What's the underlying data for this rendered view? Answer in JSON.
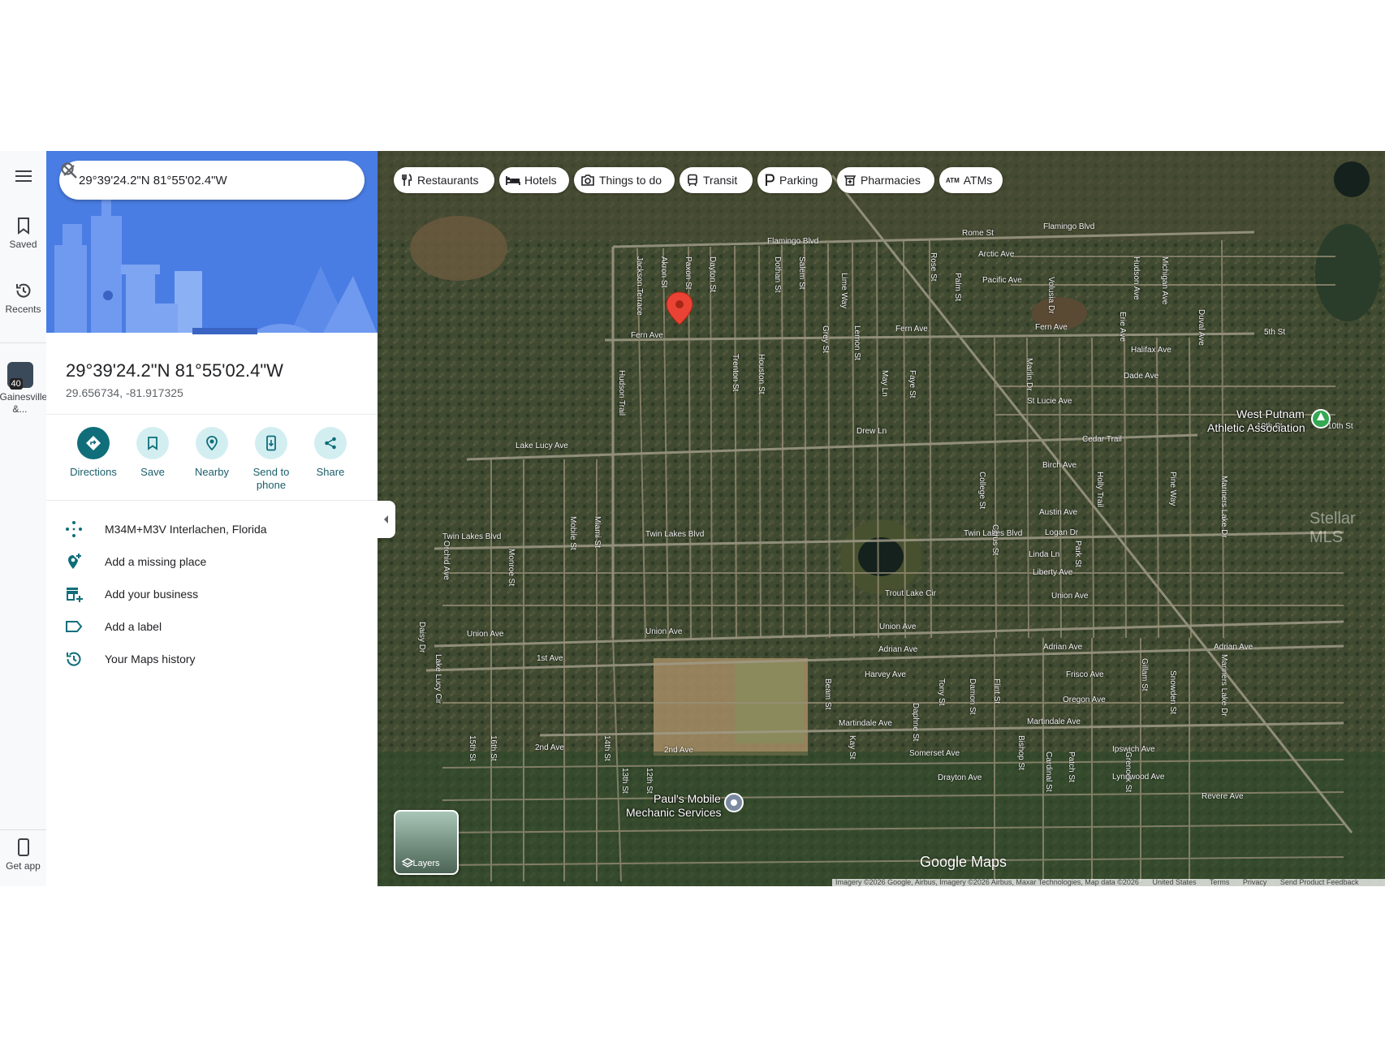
{
  "rail": {
    "saved_label": "Saved",
    "recents_label": "Recents",
    "recent_place_label": "Gainesville &...",
    "recent_place_badge": "40",
    "get_app_label": "Get app"
  },
  "search": {
    "value": "29°39'24.2\"N 81°55'02.4\"W"
  },
  "place": {
    "title": "29°39'24.2\"N 81°55'02.4\"W",
    "coords": "29.656734, -81.917325"
  },
  "actions": {
    "directions": "Directions",
    "save": "Save",
    "nearby": "Nearby",
    "send_line1": "Send to",
    "send_line2": "phone",
    "share": "Share"
  },
  "info": {
    "plus_code": "M34M+M3V Interlachen, Florida",
    "add_missing_place": "Add a missing place",
    "add_business": "Add your business",
    "add_label": "Add a label",
    "maps_history": "Your Maps history"
  },
  "chips": {
    "restaurants": "Restaurants",
    "hotels": "Hotels",
    "things_to_do": "Things to do",
    "transit": "Transit",
    "parking": "Parking",
    "pharmacies": "Pharmacies",
    "atms": "ATMs",
    "atm_glyph": "ATM"
  },
  "map": {
    "layers_label": "Layers",
    "logo": "Google Maps",
    "watermark": "Stellar MLS",
    "poi_west_putnam_1": "West Putnam",
    "poi_west_putnam_2": "Athletic Association",
    "poi_pauls_1": "Paul's Mobile",
    "poi_pauls_2": "Mechanic Services",
    "attribution": "Imagery ©2026 Google, Airbus, Imagery ©2026 Airbus, Maxar Technologies, Map data ©2026",
    "attr_us": "United States",
    "attr_terms": "Terms",
    "attr_privacy": "Privacy",
    "attr_feedback": "Send Product Feedback",
    "streets_h": [
      "Flamingo Blvd",
      "Rome St",
      "Flamingo Blvd",
      "Arctic Ave",
      "Pacific Ave",
      "Fern Ave",
      "Fern Ave",
      "Fern Ave",
      "5th St",
      "Halifax Ave",
      "Dade Ave",
      "St Lucie Ave",
      "10th St",
      "10th St",
      "Drew Ln",
      "Lake Lucy Ave",
      "Cedar Trail",
      "Birch Ave",
      "Austin Ave",
      "Twin Lakes Blvd",
      "Twin Lakes Blvd",
      "Twin Lakes Blvd",
      "Logan Dr",
      "Linda Ln",
      "Liberty Ave",
      "Union Ave",
      "Union Ave",
      "Union Ave",
      "Union Ave",
      "1st Ave",
      "Adrian Ave",
      "Adrian Ave",
      "Adrian Ave",
      "Harvey Ave",
      "Frisco Ave",
      "Oregon Ave",
      "Martindale Ave",
      "Martindale Ave",
      "2nd Ave",
      "2nd Ave",
      "Somerset Ave",
      "Ipswich Ave",
      "Drayton Ave",
      "Lynnwood Ave",
      "Revere Ave",
      "Trout Lake Cir"
    ],
    "streets_v": [
      "Jackson Terrace",
      "Akron St",
      "Paxon St",
      "Dayton St",
      "Dothan St",
      "Salem St",
      "Lime Way",
      "Rose St",
      "Palm St",
      "Volusia Dr",
      "Hudson Ave",
      "Michigan Ave",
      "Duval Ave",
      "Hudson Trail",
      "Trenton St",
      "Houston St",
      "Lemon St",
      "Grey St",
      "May Ln",
      "Faye St",
      "Marlin Dr",
      "Erie Ave",
      "College St",
      "Holly Trail",
      "Pine Way",
      "Mariners Lake Dr",
      "Mobile St",
      "Miami St",
      "Orchid Ave",
      "Monroe St",
      "Citrus St",
      "Park St",
      "Beam St",
      "Tony St",
      "Damon St",
      "Flint St",
      "Daphne St",
      "Gillam St",
      "Snowden St",
      "Lake Lucy Cir",
      "15th St",
      "16th St",
      "14th St",
      "13th St",
      "12th St",
      "Kay St",
      "Bishop St",
      "Cardinal St",
      "Patch St",
      "Grenock St",
      "Mariners Lake Dr",
      "Daisy Dr"
    ]
  }
}
